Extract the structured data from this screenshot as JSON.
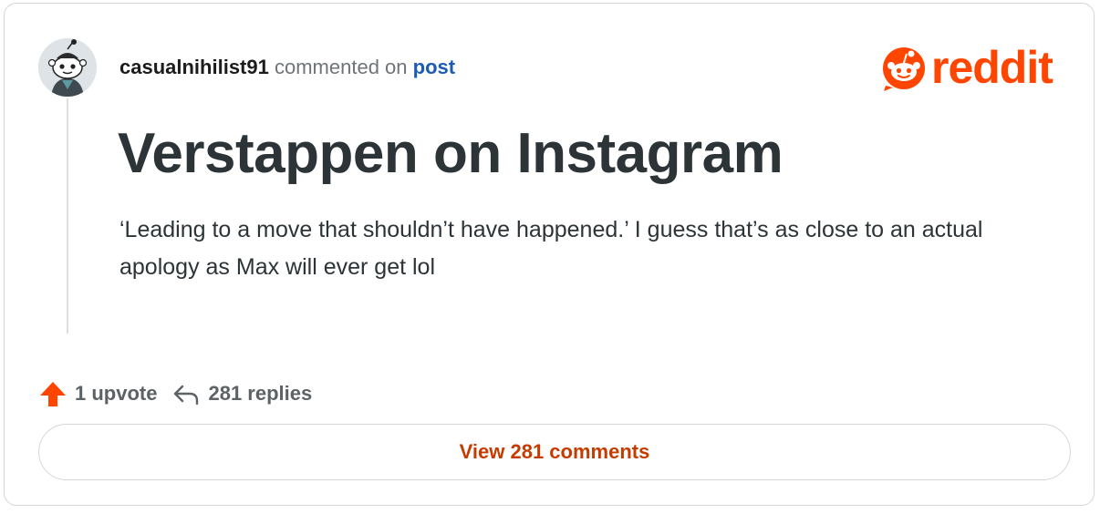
{
  "header": {
    "username": "casualnihilist91",
    "commented_text": "commented on",
    "post_link": "post"
  },
  "logo": {
    "wordmark": "reddit",
    "icon": "reddit-snoo-icon",
    "color": "#ff4500"
  },
  "title": "Verstappen on Instagram",
  "comment_body": "‘Leading to a move that shouldn’t have happened.’ I guess that’s as close to an actual apology as Max will ever get lol",
  "actions": {
    "upvote_icon": "upvote-arrow-icon",
    "upvote_label": "1 upvote",
    "reply_icon": "reply-arrow-icon",
    "replies_label": "281 replies"
  },
  "view_button": {
    "label": "View 281 comments"
  },
  "colors": {
    "accent": "#ff4500",
    "link": "#1a5bb4",
    "button_text": "#c63c00",
    "title_text": "#2c3438"
  }
}
